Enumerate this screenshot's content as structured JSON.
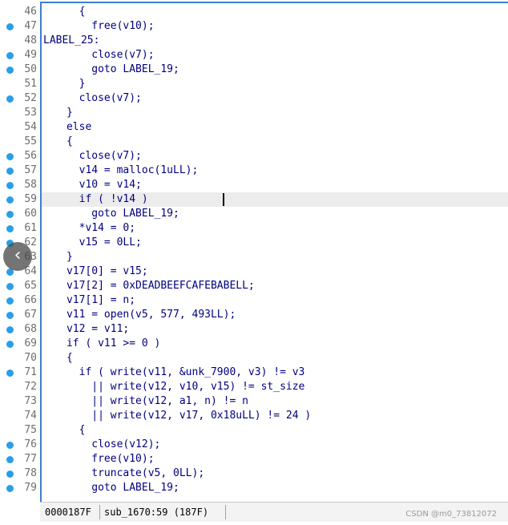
{
  "lines": [
    {
      "no": "46",
      "bp": false,
      "code": "        {"
    },
    {
      "no": "47",
      "bp": true,
      "code": "          free(v10);"
    },
    {
      "no": "48",
      "bp": false,
      "code": "LABEL_25:",
      "label": true
    },
    {
      "no": "49",
      "bp": true,
      "code": "          close(v7);"
    },
    {
      "no": "50",
      "bp": true,
      "code": "          goto LABEL_19;"
    },
    {
      "no": "51",
      "bp": false,
      "code": "        }"
    },
    {
      "no": "52",
      "bp": true,
      "code": "        close(v7);"
    },
    {
      "no": "53",
      "bp": false,
      "code": "      }"
    },
    {
      "no": "54",
      "bp": false,
      "code": "      else"
    },
    {
      "no": "55",
      "bp": false,
      "code": "      {"
    },
    {
      "no": "56",
      "bp": true,
      "code": "        close(v7);"
    },
    {
      "no": "57",
      "bp": true,
      "code": "        v14 = malloc(1uLL);"
    },
    {
      "no": "58",
      "bp": true,
      "code": "        v10 = v14;"
    },
    {
      "no": "59",
      "bp": true,
      "code": "        if ( !v14 )",
      "highlight": true
    },
    {
      "no": "60",
      "bp": true,
      "code": "          goto LABEL_19;"
    },
    {
      "no": "61",
      "bp": true,
      "code": "        *v14 = 0;"
    },
    {
      "no": "62",
      "bp": true,
      "code": "        v15 = 0LL;"
    },
    {
      "no": "63",
      "bp": false,
      "code": "      }"
    },
    {
      "no": "64",
      "bp": true,
      "code": "      v17[0] = v15;"
    },
    {
      "no": "65",
      "bp": true,
      "code": "      v17[2] = 0xDEADBEEFCAFEBABELL;"
    },
    {
      "no": "66",
      "bp": true,
      "code": "      v17[1] = n;"
    },
    {
      "no": "67",
      "bp": true,
      "code": "      v11 = open(v5, 577, 493LL);"
    },
    {
      "no": "68",
      "bp": true,
      "code": "      v12 = v11;"
    },
    {
      "no": "69",
      "bp": true,
      "code": "      if ( v11 >= 0 )"
    },
    {
      "no": "70",
      "bp": false,
      "code": "      {"
    },
    {
      "no": "71",
      "bp": true,
      "code": "        if ( write(v11, &unk_7900, v3) != v3"
    },
    {
      "no": "72",
      "bp": false,
      "code": "          || write(v12, v10, v15) != st_size"
    },
    {
      "no": "73",
      "bp": false,
      "code": "          || write(v12, a1, n) != n"
    },
    {
      "no": "74",
      "bp": false,
      "code": "          || write(v12, v17, 0x18uLL) != 24 )"
    },
    {
      "no": "75",
      "bp": false,
      "code": "        {"
    },
    {
      "no": "76",
      "bp": true,
      "code": "          close(v12);"
    },
    {
      "no": "77",
      "bp": true,
      "code": "          free(v10);"
    },
    {
      "no": "78",
      "bp": true,
      "code": "          truncate(v5, 0LL);"
    },
    {
      "no": "79",
      "bp": true,
      "code": "          goto LABEL_19;"
    }
  ],
  "status": {
    "address": "0000187F",
    "location": "sub_1670:59 (187F)"
  },
  "watermark": "CSDN @m0_73812072",
  "nav_button_glyph": "‹",
  "colors": {
    "code_text": "#000080",
    "variable": "#6a6a9a",
    "line_number": "#6d6d6d",
    "breakpoint": "#2a9ee8",
    "highlight_line": "#ececec",
    "border": "#3c7fd1"
  }
}
